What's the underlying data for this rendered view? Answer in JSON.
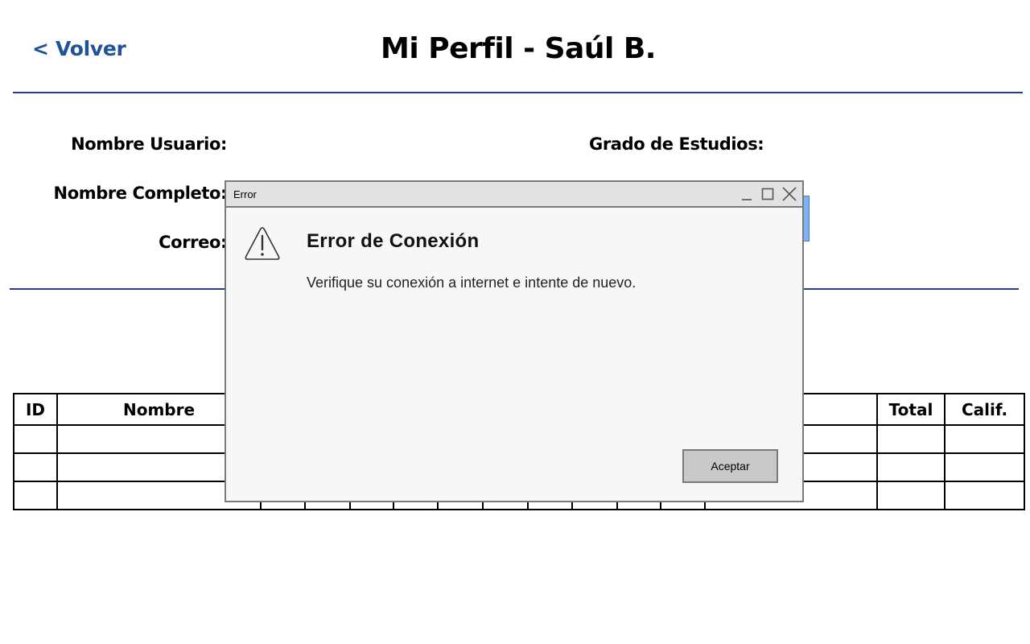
{
  "header": {
    "back_label": "< Volver",
    "title": "Mi Perfil - Saúl B."
  },
  "profile": {
    "username_label": "Nombre Usuario:",
    "fullname_label": "Nombre Completo:",
    "email_label": "Correo:",
    "degree_label": "Grado de Estudios:"
  },
  "table": {
    "columns": [
      "ID",
      "Nombre",
      "",
      "",
      "",
      "",
      "",
      "",
      "",
      "",
      "",
      "",
      "",
      "Total",
      "Calif."
    ],
    "rows": [
      [
        "",
        "",
        "",
        "",
        "",
        "",
        "",
        "",
        "",
        "",
        "",
        "",
        "",
        "",
        ""
      ],
      [
        "",
        "",
        "",
        "",
        "",
        "",
        "",
        "",
        "",
        "",
        "",
        "",
        "",
        "",
        ""
      ],
      [
        "",
        "",
        "",
        "",
        "",
        "",
        "",
        "",
        "",
        "",
        "",
        "",
        "",
        "",
        ""
      ]
    ]
  },
  "dialog": {
    "window_title": "Error",
    "heading": "Error de Conexión",
    "message": "Verifique su conexión a internet e intente de nuevo.",
    "accept_label": "Aceptar",
    "icon": "warning-icon"
  },
  "colors": {
    "accent": "#1f5296",
    "divider": "#243f86",
    "dialog_bg": "#f7f7f7",
    "titlebar_bg": "#e2e2e2",
    "button_bg": "#c9c9c9"
  }
}
